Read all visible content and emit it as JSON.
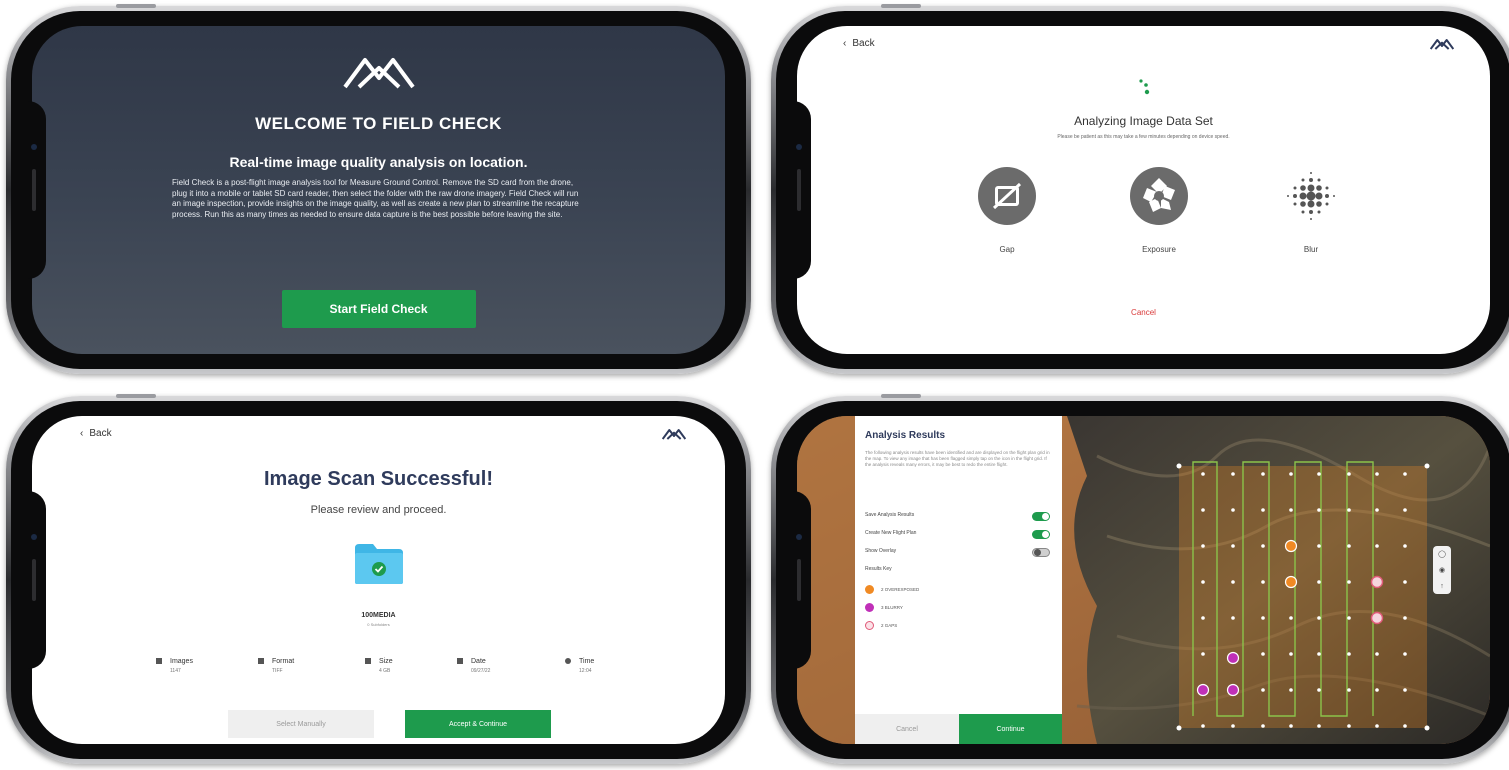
{
  "screen1": {
    "title": "WELCOME TO FIELD CHECK",
    "subtitle": "Real-time image quality analysis on location.",
    "body": "Field Check is a post-flight image analysis tool for Measure Ground Control. Remove the SD card from the drone, plug it into a mobile or tablet SD card reader, then select the folder with the raw drone imagery. Field Check will run an image inspection, provide insights on the image quality, as well as create a new plan to streamline the recapture process. Run this as many times as needed to ensure data capture is the best possible before leaving the site.",
    "start_button": "Start Field Check",
    "logo_icon": "measure-logo-icon"
  },
  "screen2": {
    "back_label": "Back",
    "title": "Analyzing Image Data Set",
    "subtitle": "Please be patient as this may take a few minutes depending on device speed.",
    "metrics": [
      {
        "label": "Gap",
        "icon": "gap-icon"
      },
      {
        "label": "Exposure",
        "icon": "aperture-icon"
      },
      {
        "label": "Blur",
        "icon": "blur-icon"
      }
    ],
    "cancel_label": "Cancel"
  },
  "screen3": {
    "back_label": "Back",
    "title": "Image Scan Successful!",
    "subtitle": "Please review and proceed.",
    "folder_name": "100MEDIA",
    "folder_count": "0 Subfolders",
    "stats": [
      {
        "label": "Images",
        "value": "1147",
        "icon": "images-icon"
      },
      {
        "label": "Format",
        "value": "TIFF",
        "icon": "format-icon"
      },
      {
        "label": "Size",
        "value": "4 GB",
        "icon": "size-icon"
      },
      {
        "label": "Date",
        "value": "09/27/22",
        "icon": "calendar-icon"
      },
      {
        "label": "Time",
        "value": "12:04",
        "icon": "clock-icon"
      }
    ],
    "select_manually": "Select Manually",
    "accept_continue": "Accept & Continue"
  },
  "screen4": {
    "panel_title": "Analysis Results",
    "panel_desc": "The following analysis results have been identified and are displayed on the flight plan grid in the map. To view any image that has been flagged simply tap on the icon in the flight grid. If the analysis reveals many errors, it may be best to redo the entire flight.",
    "toggles": [
      {
        "label": "Save Analysis Results",
        "on": true
      },
      {
        "label": "Create New Flight Plan",
        "on": true
      },
      {
        "label": "Show Overlay",
        "on": false
      }
    ],
    "results_key_label": "Results Key",
    "results": [
      {
        "label": "2 OVEREXPOSED",
        "color": "#f08a24"
      },
      {
        "label": "3 BLURRY",
        "color": "#c030b8"
      },
      {
        "label": "2 GAPS",
        "color": "#e05a78"
      }
    ],
    "cancel_label": "Cancel",
    "continue_label": "Continue",
    "map_controls": [
      "compass-icon",
      "location-icon",
      "layers-icon"
    ]
  },
  "colors": {
    "accent_green": "#1e9b4d",
    "title_navy": "#2f3b5c",
    "cancel_red": "#d93939",
    "welcome_bg": "#353e4d"
  }
}
